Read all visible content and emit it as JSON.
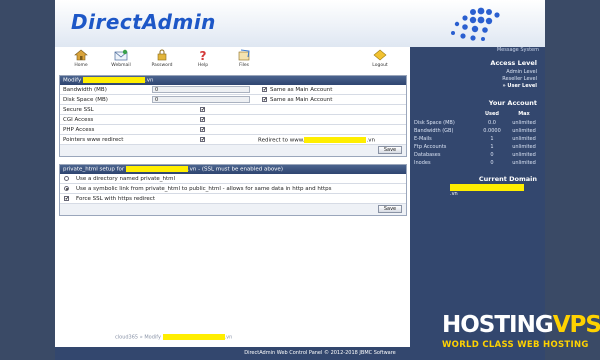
{
  "header": {
    "logo_text": "DirectAdmin"
  },
  "toolbar": [
    {
      "label": "Home",
      "icon": "home-icon"
    },
    {
      "label": "Webmail",
      "icon": "webmail-icon"
    },
    {
      "label": "Password",
      "icon": "password-icon"
    },
    {
      "label": "Help",
      "icon": "help-icon"
    },
    {
      "label": "Files",
      "icon": "files-icon"
    },
    {
      "label": "Logout",
      "icon": "logout-icon"
    }
  ],
  "sidebar": {
    "message_system": "Message System",
    "access_level_title": "Access Level",
    "access_levels": [
      "Admin Level",
      "Reseller Level",
      "» User Level"
    ],
    "your_account_title": "Your Account",
    "usage_headers": {
      "used": "Used",
      "max": "Max"
    },
    "usage_rows": [
      {
        "name": "Disk Space (MB)",
        "used": "0.0",
        "max": "unlimited"
      },
      {
        "name": "Bandwidth (GB)",
        "used": "0.0000",
        "max": "unlimited"
      },
      {
        "name": "E-Mails",
        "used": "1",
        "max": "unlimited"
      },
      {
        "name": "Ftp Accounts",
        "used": "1",
        "max": "unlimited"
      },
      {
        "name": "Databases",
        "used": "0",
        "max": "unlimited"
      },
      {
        "name": "Inodes",
        "used": "0",
        "max": "unlimited"
      }
    ],
    "current_domain_title": "Current Domain",
    "current_domain_suffix": ".vn"
  },
  "modify": {
    "title_prefix": "Modify",
    "title_suffix": ".vn",
    "bandwidth_label": "Bandwidth (MB)",
    "bandwidth_value": "0",
    "bandwidth_same": "Same as Main Account",
    "disk_label": "Disk Space (MB)",
    "disk_value": "0",
    "disk_same": "Same as Main Account",
    "ssl_label": "Secure SSL",
    "cgi_label": "CGI Access",
    "php_label": "PHP Access",
    "pointers_label": "Pointers www redirect",
    "redirect_prefix": "Redirect to www.",
    "redirect_suffix": ".vn",
    "save_label": "Save"
  },
  "private_html": {
    "title_prefix": "private_html setup for",
    "title_suffix": ".vn - (SSL must be enabled above)",
    "options": [
      "Use a directory named private_html",
      "Use a symbolic link from private_html to public_html - allows for same data in http and https",
      "Force SSL with https redirect"
    ],
    "save_label": "Save"
  },
  "breadcrumb": {
    "root": "cloud365",
    "arrow": "»",
    "page": "Modify",
    "suffix": ".vn"
  },
  "footer": "DirectAdmin Web Control Panel © 2012-2018 JBMC Software",
  "brand": {
    "part1": "HOSTING",
    "part2": "VPS",
    "tagline": "WORLD CLASS WEB HOSTING"
  }
}
